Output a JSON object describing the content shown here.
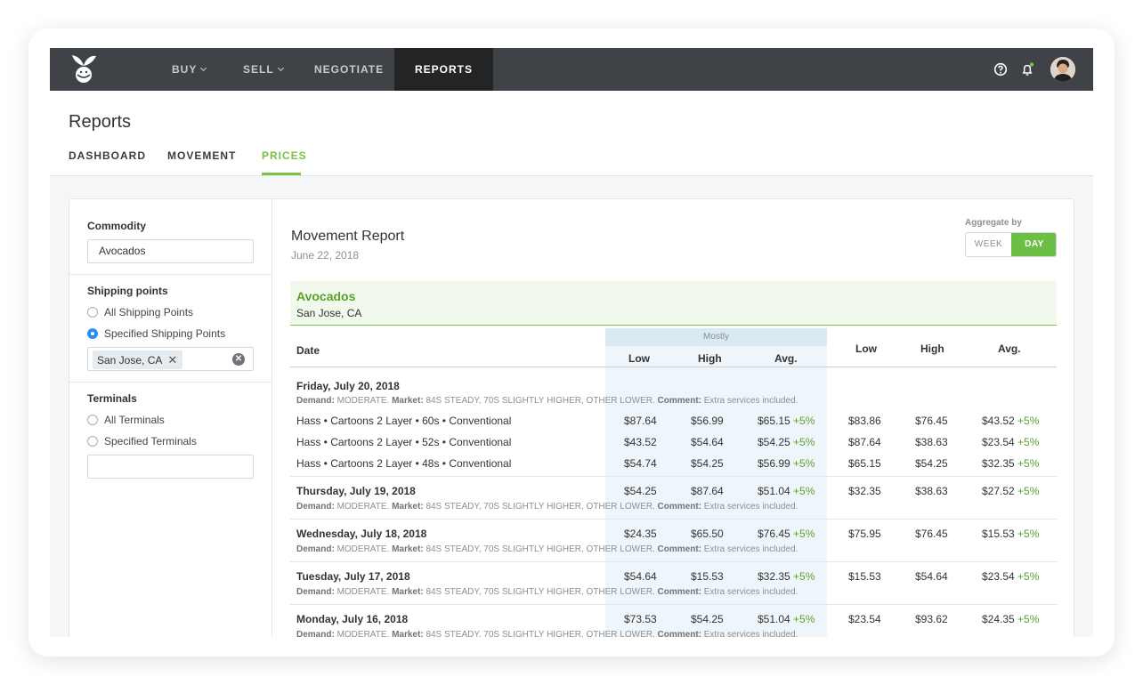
{
  "nav": {
    "items": [
      {
        "label": "BUY",
        "has_menu": true
      },
      {
        "label": "SELL",
        "has_menu": true
      },
      {
        "label": "NEGOTIATE",
        "has_menu": false
      },
      {
        "label": "REPORTS",
        "has_menu": false,
        "active": true
      }
    ]
  },
  "page": {
    "title": "Reports",
    "tabs": [
      {
        "label": "DASHBOARD"
      },
      {
        "label": "MOVEMENT"
      },
      {
        "label": "PRICES",
        "active": true
      }
    ]
  },
  "sidebar": {
    "commodity_label": "Commodity",
    "commodity_value": "Avocados",
    "shipping_label": "Shipping points",
    "shipping_all": "All Shipping Points",
    "shipping_specified": "Specified Shipping Points",
    "shipping_chip": "San Jose, CA",
    "terminals_label": "Terminals",
    "terminals_all": "All Terminals",
    "terminals_specified": "Specified Terminals",
    "terminals_value": ""
  },
  "report": {
    "title": "Movement Report",
    "date": "June 22, 2018",
    "aggregate_label": "Aggregate by",
    "aggregate_week": "WEEK",
    "aggregate_day": "DAY",
    "commodity": "Avocados",
    "location": "San Jose, CA",
    "headers": {
      "date": "Date",
      "mostly": "Mostly",
      "low": "Low",
      "high": "High",
      "avg": "Avg.",
      "low2": "Low",
      "high2": "High",
      "avg2": "Avg."
    },
    "meta": {
      "demand_label": "Demand:",
      "demand": "MODERATE.",
      "market_label": "Market:",
      "market": "84S STEADY, 70S SLIGHTLY HIGHER, OTHER LOWER.",
      "comment_label": "Comment:",
      "comment": "Extra services included."
    },
    "day1": {
      "title": "Friday, July 20, 2018",
      "rows": [
        {
          "product": "Hass • Cartoons 2 Layer • 60s • Conventional",
          "low": "$87.64",
          "high": "$56.99",
          "avg": "$65.15",
          "avg_pct": "+5%",
          "low2": "$83.86",
          "high2": "$76.45",
          "avg2": "$43.52",
          "avg2_pct": "+5%"
        },
        {
          "product": "Hass • Cartoons 2 Layer • 52s • Conventional",
          "low": "$43.52",
          "high": "$54.64",
          "avg": "$54.25",
          "avg_pct": "+5%",
          "low2": "$87.64",
          "high2": "$38.63",
          "avg2": "$23.54",
          "avg2_pct": "+5%"
        },
        {
          "product": "Hass • Cartoons 2 Layer • 48s • Conventional",
          "low": "$54.74",
          "high": "$54.25",
          "avg": "$56.99",
          "avg_pct": "+5%",
          "low2": "$65.15",
          "high2": "$54.25",
          "avg2": "$32.35",
          "avg2_pct": "+5%"
        }
      ]
    },
    "days": [
      {
        "title": "Thursday, July 19, 2018",
        "low": "$54.25",
        "high": "$87.64",
        "avg": "$51.04",
        "avg_pct": "+5%",
        "low2": "$32.35",
        "high2": "$38.63",
        "avg2": "$27.52",
        "avg2_pct": "+5%"
      },
      {
        "title": "Wednesday, July 18, 2018",
        "low": "$24.35",
        "high": "$65.50",
        "avg": "$76.45",
        "avg_pct": "+5%",
        "low2": "$75.95",
        "high2": "$76.45",
        "avg2": "$15.53",
        "avg2_pct": "+5%"
      },
      {
        "title": "Tuesday, July 17, 2018",
        "low": "$54.64",
        "high": "$15.53",
        "avg": "$32.35",
        "avg_pct": "+5%",
        "low2": "$15.53",
        "high2": "$54.64",
        "avg2": "$23.54",
        "avg2_pct": "+5%"
      },
      {
        "title": "Monday, July 16, 2018",
        "low": "$73.53",
        "high": "$54.25",
        "avg": "$51.04",
        "avg_pct": "+5%",
        "low2": "$23.54",
        "high2": "$93.62",
        "avg2": "$24.35",
        "avg2_pct": "+5%"
      }
    ]
  },
  "colors": {
    "nav_bg": "#3f4348",
    "nav_active_bg": "#222426",
    "accent_green": "#7ac143",
    "radio_blue": "#2b8cf2",
    "mostly_bg": "#eef6fb"
  }
}
